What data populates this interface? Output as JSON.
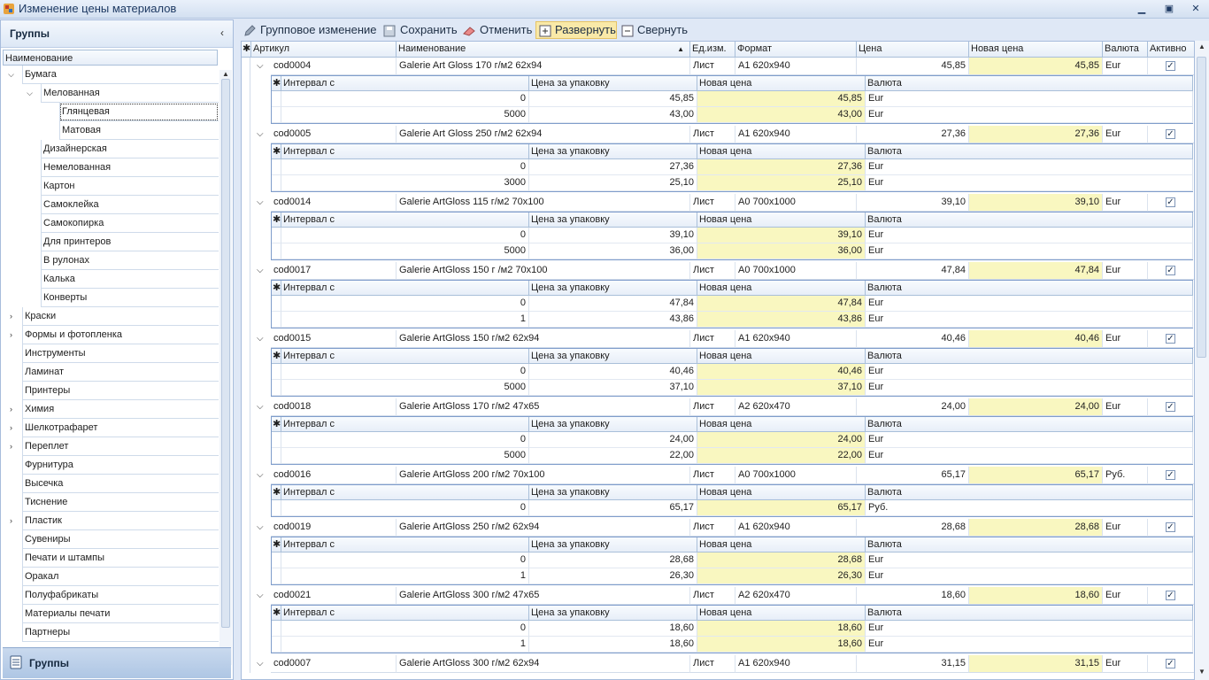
{
  "window": {
    "title": "Изменение цены материалов"
  },
  "left_panel": {
    "header": "Группы",
    "column": "Наименование",
    "tree": [
      {
        "label": "Бумага",
        "level": 0,
        "expander": "open"
      },
      {
        "label": "Мелованная",
        "level": 1,
        "expander": "open"
      },
      {
        "label": "Глянцевая",
        "level": 2,
        "expander": "",
        "selected": true
      },
      {
        "label": "Матовая",
        "level": 2,
        "expander": ""
      },
      {
        "label": "Дизайнерская",
        "level": 1,
        "expander": ""
      },
      {
        "label": "Немелованная",
        "level": 1,
        "expander": ""
      },
      {
        "label": "Картон",
        "level": 1,
        "expander": ""
      },
      {
        "label": "Самоклейка",
        "level": 1,
        "expander": ""
      },
      {
        "label": "Самокопирка",
        "level": 1,
        "expander": ""
      },
      {
        "label": "Для принтеров",
        "level": 1,
        "expander": ""
      },
      {
        "label": "В рулонах",
        "level": 1,
        "expander": ""
      },
      {
        "label": "Калька",
        "level": 1,
        "expander": ""
      },
      {
        "label": "Конверты",
        "level": 1,
        "expander": ""
      },
      {
        "label": "Краски",
        "level": 0,
        "expander": "closed"
      },
      {
        "label": "Формы и фотопленка",
        "level": 0,
        "expander": "closed"
      },
      {
        "label": "Инструменты",
        "level": 0,
        "expander": ""
      },
      {
        "label": "Ламинат",
        "level": 0,
        "expander": ""
      },
      {
        "label": "Принтеры",
        "level": 0,
        "expander": ""
      },
      {
        "label": "Химия",
        "level": 0,
        "expander": "closed"
      },
      {
        "label": "Шелкотрафарет",
        "level": 0,
        "expander": "closed"
      },
      {
        "label": "Переплет",
        "level": 0,
        "expander": "closed"
      },
      {
        "label": "Фурнитура",
        "level": 0,
        "expander": ""
      },
      {
        "label": "Высечка",
        "level": 0,
        "expander": ""
      },
      {
        "label": "Тиснение",
        "level": 0,
        "expander": ""
      },
      {
        "label": "Пластик",
        "level": 0,
        "expander": "closed"
      },
      {
        "label": "Сувениры",
        "level": 0,
        "expander": ""
      },
      {
        "label": "Печати и штампы",
        "level": 0,
        "expander": ""
      },
      {
        "label": "Оракал",
        "level": 0,
        "expander": ""
      },
      {
        "label": "Полуфабрикаты",
        "level": 0,
        "expander": ""
      },
      {
        "label": "Материалы печати",
        "level": 0,
        "expander": ""
      },
      {
        "label": "Партнеры",
        "level": 0,
        "expander": ""
      }
    ],
    "footer": "Группы"
  },
  "toolbar": {
    "group_edit": "Групповое изменение",
    "save": "Сохранить",
    "cancel": "Отменить",
    "expand": "Развернуть",
    "collapse": "Свернуть"
  },
  "grid": {
    "columns": [
      "Артикул",
      "Наименование",
      "Ед.изм.",
      "Формат",
      "Цена",
      "Новая цена",
      "Валюта",
      "Активно"
    ],
    "detail_columns": [
      "Интервал с",
      "Цена за упаковку",
      "Новая цена",
      "Валюта"
    ],
    "rows": [
      {
        "code": "cod0004",
        "name": "Galerie Art Gloss 170 г/м2 62х94",
        "unit": "Лист",
        "format": "А1 620х940",
        "price": "45,85",
        "new_price": "45,85",
        "currency": "Eur",
        "active": true,
        "details": [
          {
            "from": "0",
            "pack": "45,85",
            "new": "45,85",
            "cur": "Eur"
          },
          {
            "from": "5000",
            "pack": "43,00",
            "new": "43,00",
            "cur": "Eur"
          }
        ]
      },
      {
        "code": "cod0005",
        "name": "Galerie Art Gloss 250 г/м2 62х94",
        "unit": "Лист",
        "format": "А1 620х940",
        "price": "27,36",
        "new_price": "27,36",
        "currency": "Eur",
        "active": true,
        "details": [
          {
            "from": "0",
            "pack": "27,36",
            "new": "27,36",
            "cur": "Eur"
          },
          {
            "from": "3000",
            "pack": "25,10",
            "new": "25,10",
            "cur": "Eur"
          }
        ]
      },
      {
        "code": "cod0014",
        "name": "Galerie ArtGloss 115 г/м2 70х100",
        "unit": "Лист",
        "format": "А0 700х1000",
        "price": "39,10",
        "new_price": "39,10",
        "currency": "Eur",
        "active": true,
        "details": [
          {
            "from": "0",
            "pack": "39,10",
            "new": "39,10",
            "cur": "Eur"
          },
          {
            "from": "5000",
            "pack": "36,00",
            "new": "36,00",
            "cur": "Eur"
          }
        ]
      },
      {
        "code": "cod0017",
        "name": "Galerie ArtGloss 150 г /м2 70х100",
        "unit": "Лист",
        "format": "А0 700х1000",
        "price": "47,84",
        "new_price": "47,84",
        "currency": "Eur",
        "active": true,
        "details": [
          {
            "from": "0",
            "pack": "47,84",
            "new": "47,84",
            "cur": "Eur"
          },
          {
            "from": "1",
            "pack": "43,86",
            "new": "43,86",
            "cur": "Eur"
          }
        ]
      },
      {
        "code": "cod0015",
        "name": "Galerie ArtGloss 150 г/м2 62х94",
        "unit": "Лист",
        "format": "А1 620х940",
        "price": "40,46",
        "new_price": "40,46",
        "currency": "Eur",
        "active": true,
        "details": [
          {
            "from": "0",
            "pack": "40,46",
            "new": "40,46",
            "cur": "Eur"
          },
          {
            "from": "5000",
            "pack": "37,10",
            "new": "37,10",
            "cur": "Eur"
          }
        ]
      },
      {
        "code": "cod0018",
        "name": "Galerie ArtGloss 170 г/м2 47х65",
        "unit": "Лист",
        "format": "А2 620х470",
        "price": "24,00",
        "new_price": "24,00",
        "currency": "Eur",
        "active": true,
        "details": [
          {
            "from": "0",
            "pack": "24,00",
            "new": "24,00",
            "cur": "Eur"
          },
          {
            "from": "5000",
            "pack": "22,00",
            "new": "22,00",
            "cur": "Eur"
          }
        ]
      },
      {
        "code": "cod0016",
        "name": "Galerie ArtGloss 200 г/м2 70х100",
        "unit": "Лист",
        "format": "А0 700х1000",
        "price": "65,17",
        "new_price": "65,17",
        "currency": "Руб.",
        "active": true,
        "details": [
          {
            "from": "0",
            "pack": "65,17",
            "new": "65,17",
            "cur": "Руб."
          }
        ]
      },
      {
        "code": "cod0019",
        "name": "Galerie ArtGloss 250 г/м2 62х94",
        "unit": "Лист",
        "format": "А1 620х940",
        "price": "28,68",
        "new_price": "28,68",
        "currency": "Eur",
        "active": true,
        "details": [
          {
            "from": "0",
            "pack": "28,68",
            "new": "28,68",
            "cur": "Eur"
          },
          {
            "from": "1",
            "pack": "26,30",
            "new": "26,30",
            "cur": "Eur"
          }
        ]
      },
      {
        "code": "cod0021",
        "name": "Galerie ArtGloss 300 г/м2 47х65",
        "unit": "Лист",
        "format": "А2 620х470",
        "price": "18,60",
        "new_price": "18,60",
        "currency": "Eur",
        "active": true,
        "details": [
          {
            "from": "0",
            "pack": "18,60",
            "new": "18,60",
            "cur": "Eur"
          },
          {
            "from": "1",
            "pack": "18,60",
            "new": "18,60",
            "cur": "Eur"
          }
        ]
      },
      {
        "code": "cod0007",
        "name": "Galerie ArtGloss 300 г/м2 62х94",
        "unit": "Лист",
        "format": "А1 620х940",
        "price": "31,15",
        "new_price": "31,15",
        "currency": "Eur",
        "active": true,
        "details": []
      }
    ]
  },
  "colors": {
    "accent": "#dfe8f6",
    "highlight_cell": "#f9f7c0",
    "toolbar_pressed": "#f9e9a8"
  },
  "icons": {
    "app": "palette-icon",
    "minimize": "minimize-icon",
    "maximize": "maximize-icon",
    "close": "close-icon",
    "group_edit": "pencil-icon",
    "save": "floppy-icon",
    "cancel": "eraser-icon",
    "expand": "plus-box-icon",
    "collapse": "minus-box-icon"
  }
}
